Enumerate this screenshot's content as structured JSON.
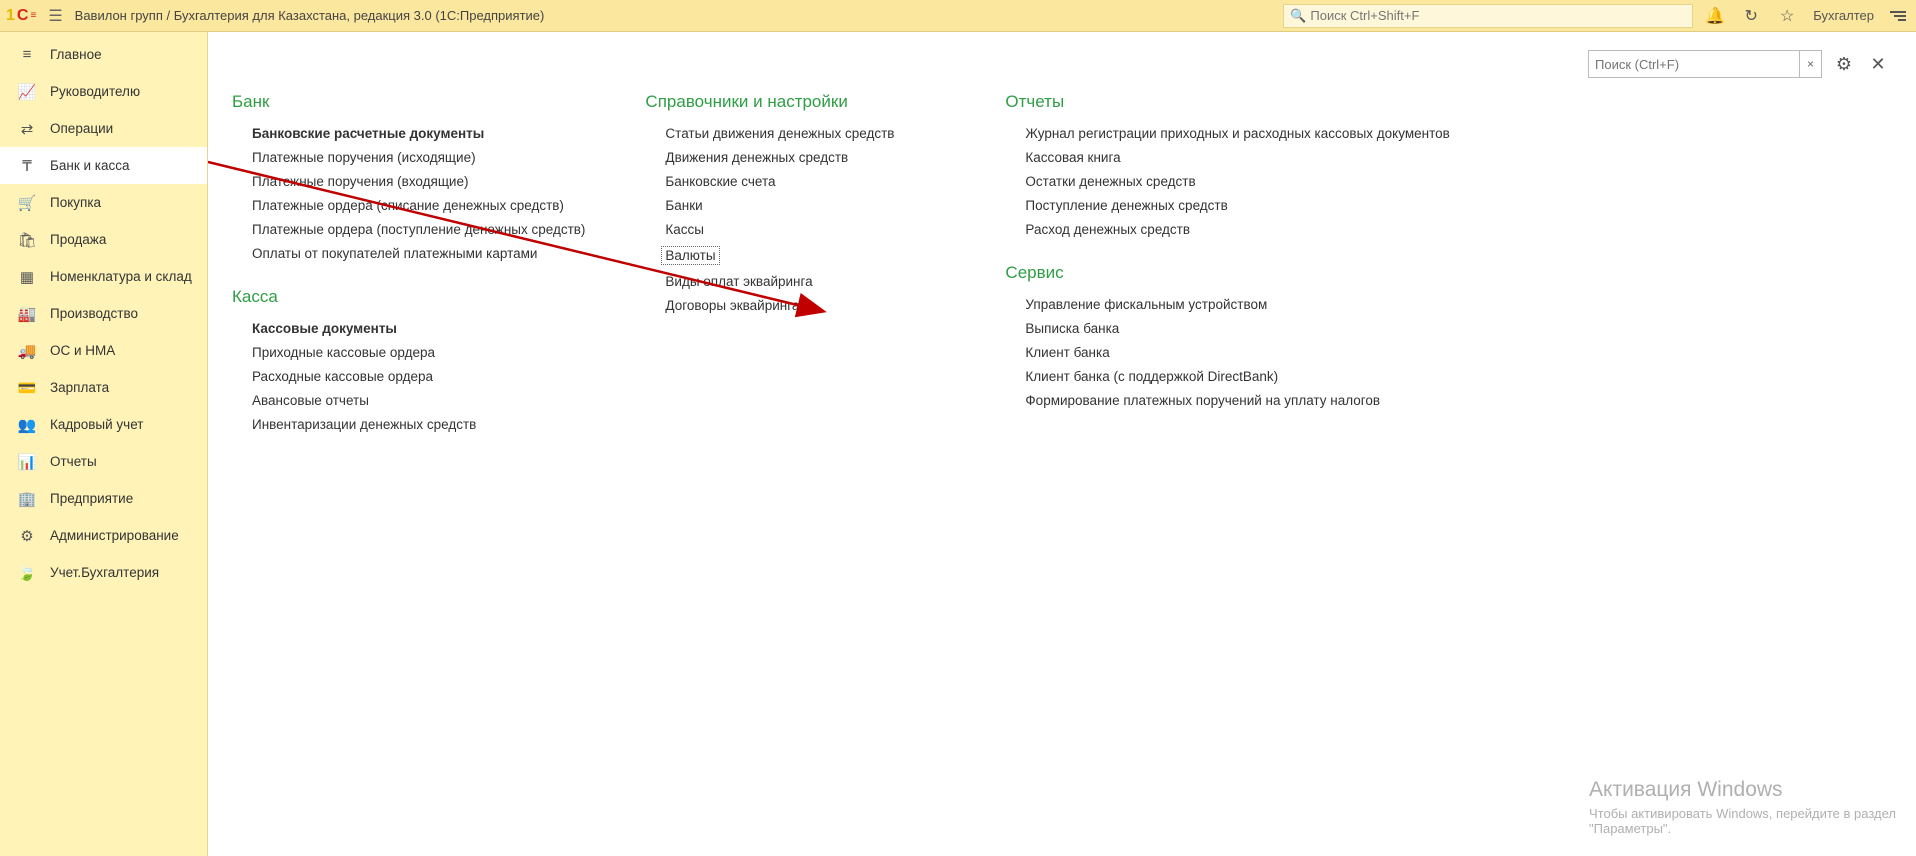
{
  "topbar": {
    "logo_text": "1C",
    "title": "Вавилон групп / Бухгалтерия для Казахстана, редакция 3.0  (1С:Предприятие)",
    "search_placeholder": "Поиск Ctrl+Shift+F",
    "user_label": "Бухгалтер"
  },
  "sidebar": {
    "items": [
      {
        "label": "Главное",
        "icon": "≡"
      },
      {
        "label": "Руководителю",
        "icon": "📈"
      },
      {
        "label": "Операции",
        "icon": "⇄"
      },
      {
        "label": "Банк и касса",
        "icon": "₸",
        "active": true
      },
      {
        "label": "Покупка",
        "icon": "🛒"
      },
      {
        "label": "Продажа",
        "icon": "🛍"
      },
      {
        "label": "Номенклатура и склад",
        "icon": "▦"
      },
      {
        "label": "Производство",
        "icon": "🏭"
      },
      {
        "label": "ОС и НМА",
        "icon": "🚚"
      },
      {
        "label": "Зарплата",
        "icon": "💳"
      },
      {
        "label": "Кадровый учет",
        "icon": "👥"
      },
      {
        "label": "Отчеты",
        "icon": "📊"
      },
      {
        "label": "Предприятие",
        "icon": "🏢"
      },
      {
        "label": "Администрирование",
        "icon": "⚙"
      },
      {
        "label": "Учет.Бухгалтерия",
        "icon": "🍃"
      }
    ]
  },
  "main": {
    "search_placeholder": "Поиск (Ctrl+F)",
    "columns": [
      {
        "sections": [
          {
            "title": "Банк",
            "links": [
              {
                "text": "Банковские расчетные документы",
                "bold": true
              },
              {
                "text": "Платежные поручения (исходящие)"
              },
              {
                "text": "Платежные поручения (входящие)"
              },
              {
                "text": "Платежные ордера (списание денежных средств)"
              },
              {
                "text": "Платежные ордера (поступление денежных средств)"
              },
              {
                "text": "Оплаты от покупателей платежными картами"
              }
            ]
          },
          {
            "title": "Касса",
            "links": [
              {
                "text": "Кассовые документы",
                "bold": true
              },
              {
                "text": "Приходные кассовые ордера"
              },
              {
                "text": "Расходные кассовые ордера"
              },
              {
                "text": "Авансовые отчеты"
              },
              {
                "text": "Инвентаризации денежных средств"
              }
            ]
          }
        ]
      },
      {
        "sections": [
          {
            "title": "Справочники и настройки",
            "links": [
              {
                "text": "Статьи движения денежных средств"
              },
              {
                "text": "Движения денежных средств"
              },
              {
                "text": "Банковские счета"
              },
              {
                "text": "Банки"
              },
              {
                "text": "Кассы"
              },
              {
                "text": "Валюты",
                "selected": true
              },
              {
                "text": "Виды оплат эквайринга"
              },
              {
                "text": "Договоры эквайринга"
              }
            ]
          }
        ]
      },
      {
        "sections": [
          {
            "title": "Отчеты",
            "links": [
              {
                "text": "Журнал регистрации приходных и расходных кассовых документов"
              },
              {
                "text": "Кассовая книга"
              },
              {
                "text": "Остатки денежных средств"
              },
              {
                "text": "Поступление денежных средств"
              },
              {
                "text": "Расход денежных средств"
              }
            ]
          },
          {
            "title": "Сервис",
            "links": [
              {
                "text": "Управление фискальным устройством"
              },
              {
                "text": "Выписка банка"
              },
              {
                "text": "Клиент банка"
              },
              {
                "text": "Клиент банка (с поддержкой DirectBank)"
              },
              {
                "text": "Формирование платежных поручений на уплату налогов"
              }
            ]
          }
        ]
      }
    ]
  },
  "watermark": {
    "title": "Активация Windows",
    "line1": "Чтобы активировать Windows, перейдите в раздел",
    "line2": "\"Параметры\"."
  }
}
